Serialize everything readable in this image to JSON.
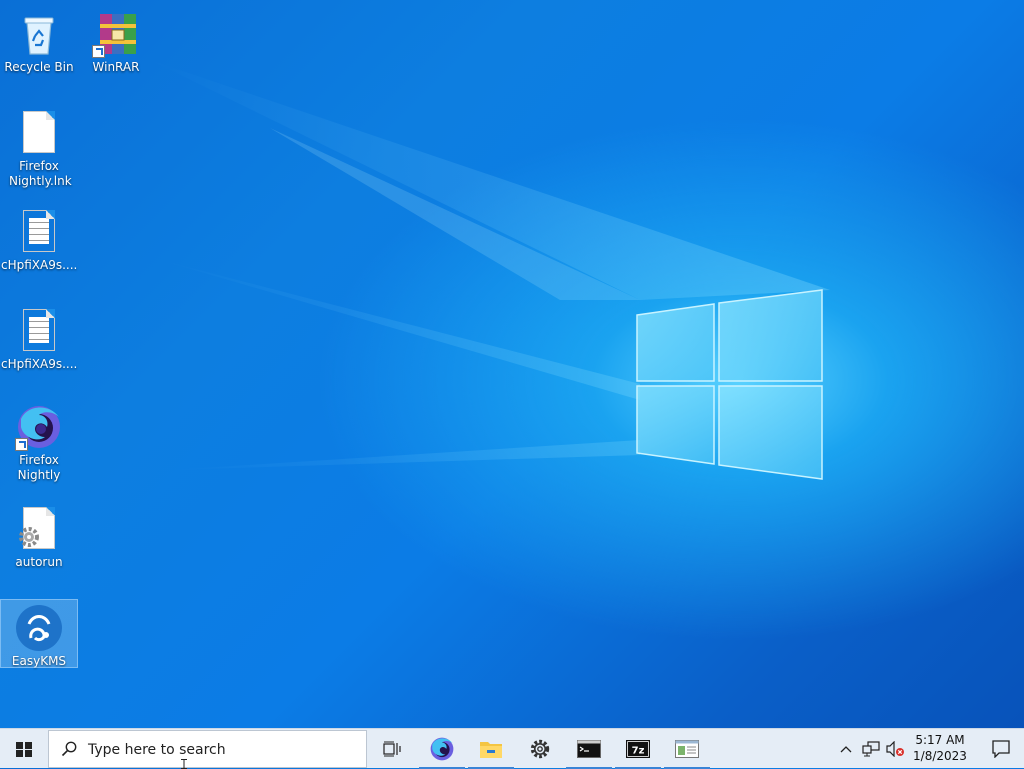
{
  "desktop": {
    "icons": [
      {
        "label": "Recycle Bin"
      },
      {
        "label": "WinRAR"
      },
      {
        "label": "Firefox Nightly.lnk"
      },
      {
        "label": "cHpfiXA9s...."
      },
      {
        "label": "cHpfiXA9s...."
      },
      {
        "label": "Firefox Nightly"
      },
      {
        "label": "autorun"
      },
      {
        "label": "EasyKMS"
      }
    ]
  },
  "taskbar": {
    "search_placeholder": "Type here to search",
    "pinned": [
      "task-view-icon",
      "firefox-nightly-icon",
      "file-explorer-icon",
      "settings-icon",
      "command-prompt-icon",
      "7zip-icon",
      "notepad-window-icon"
    ],
    "clock": {
      "time": "5:17 AM",
      "date": "1/8/2023"
    }
  },
  "colors": {
    "accent": "#0a6fd6",
    "taskbar": "#e5edf6",
    "active_indicator": "#3a84d6"
  }
}
